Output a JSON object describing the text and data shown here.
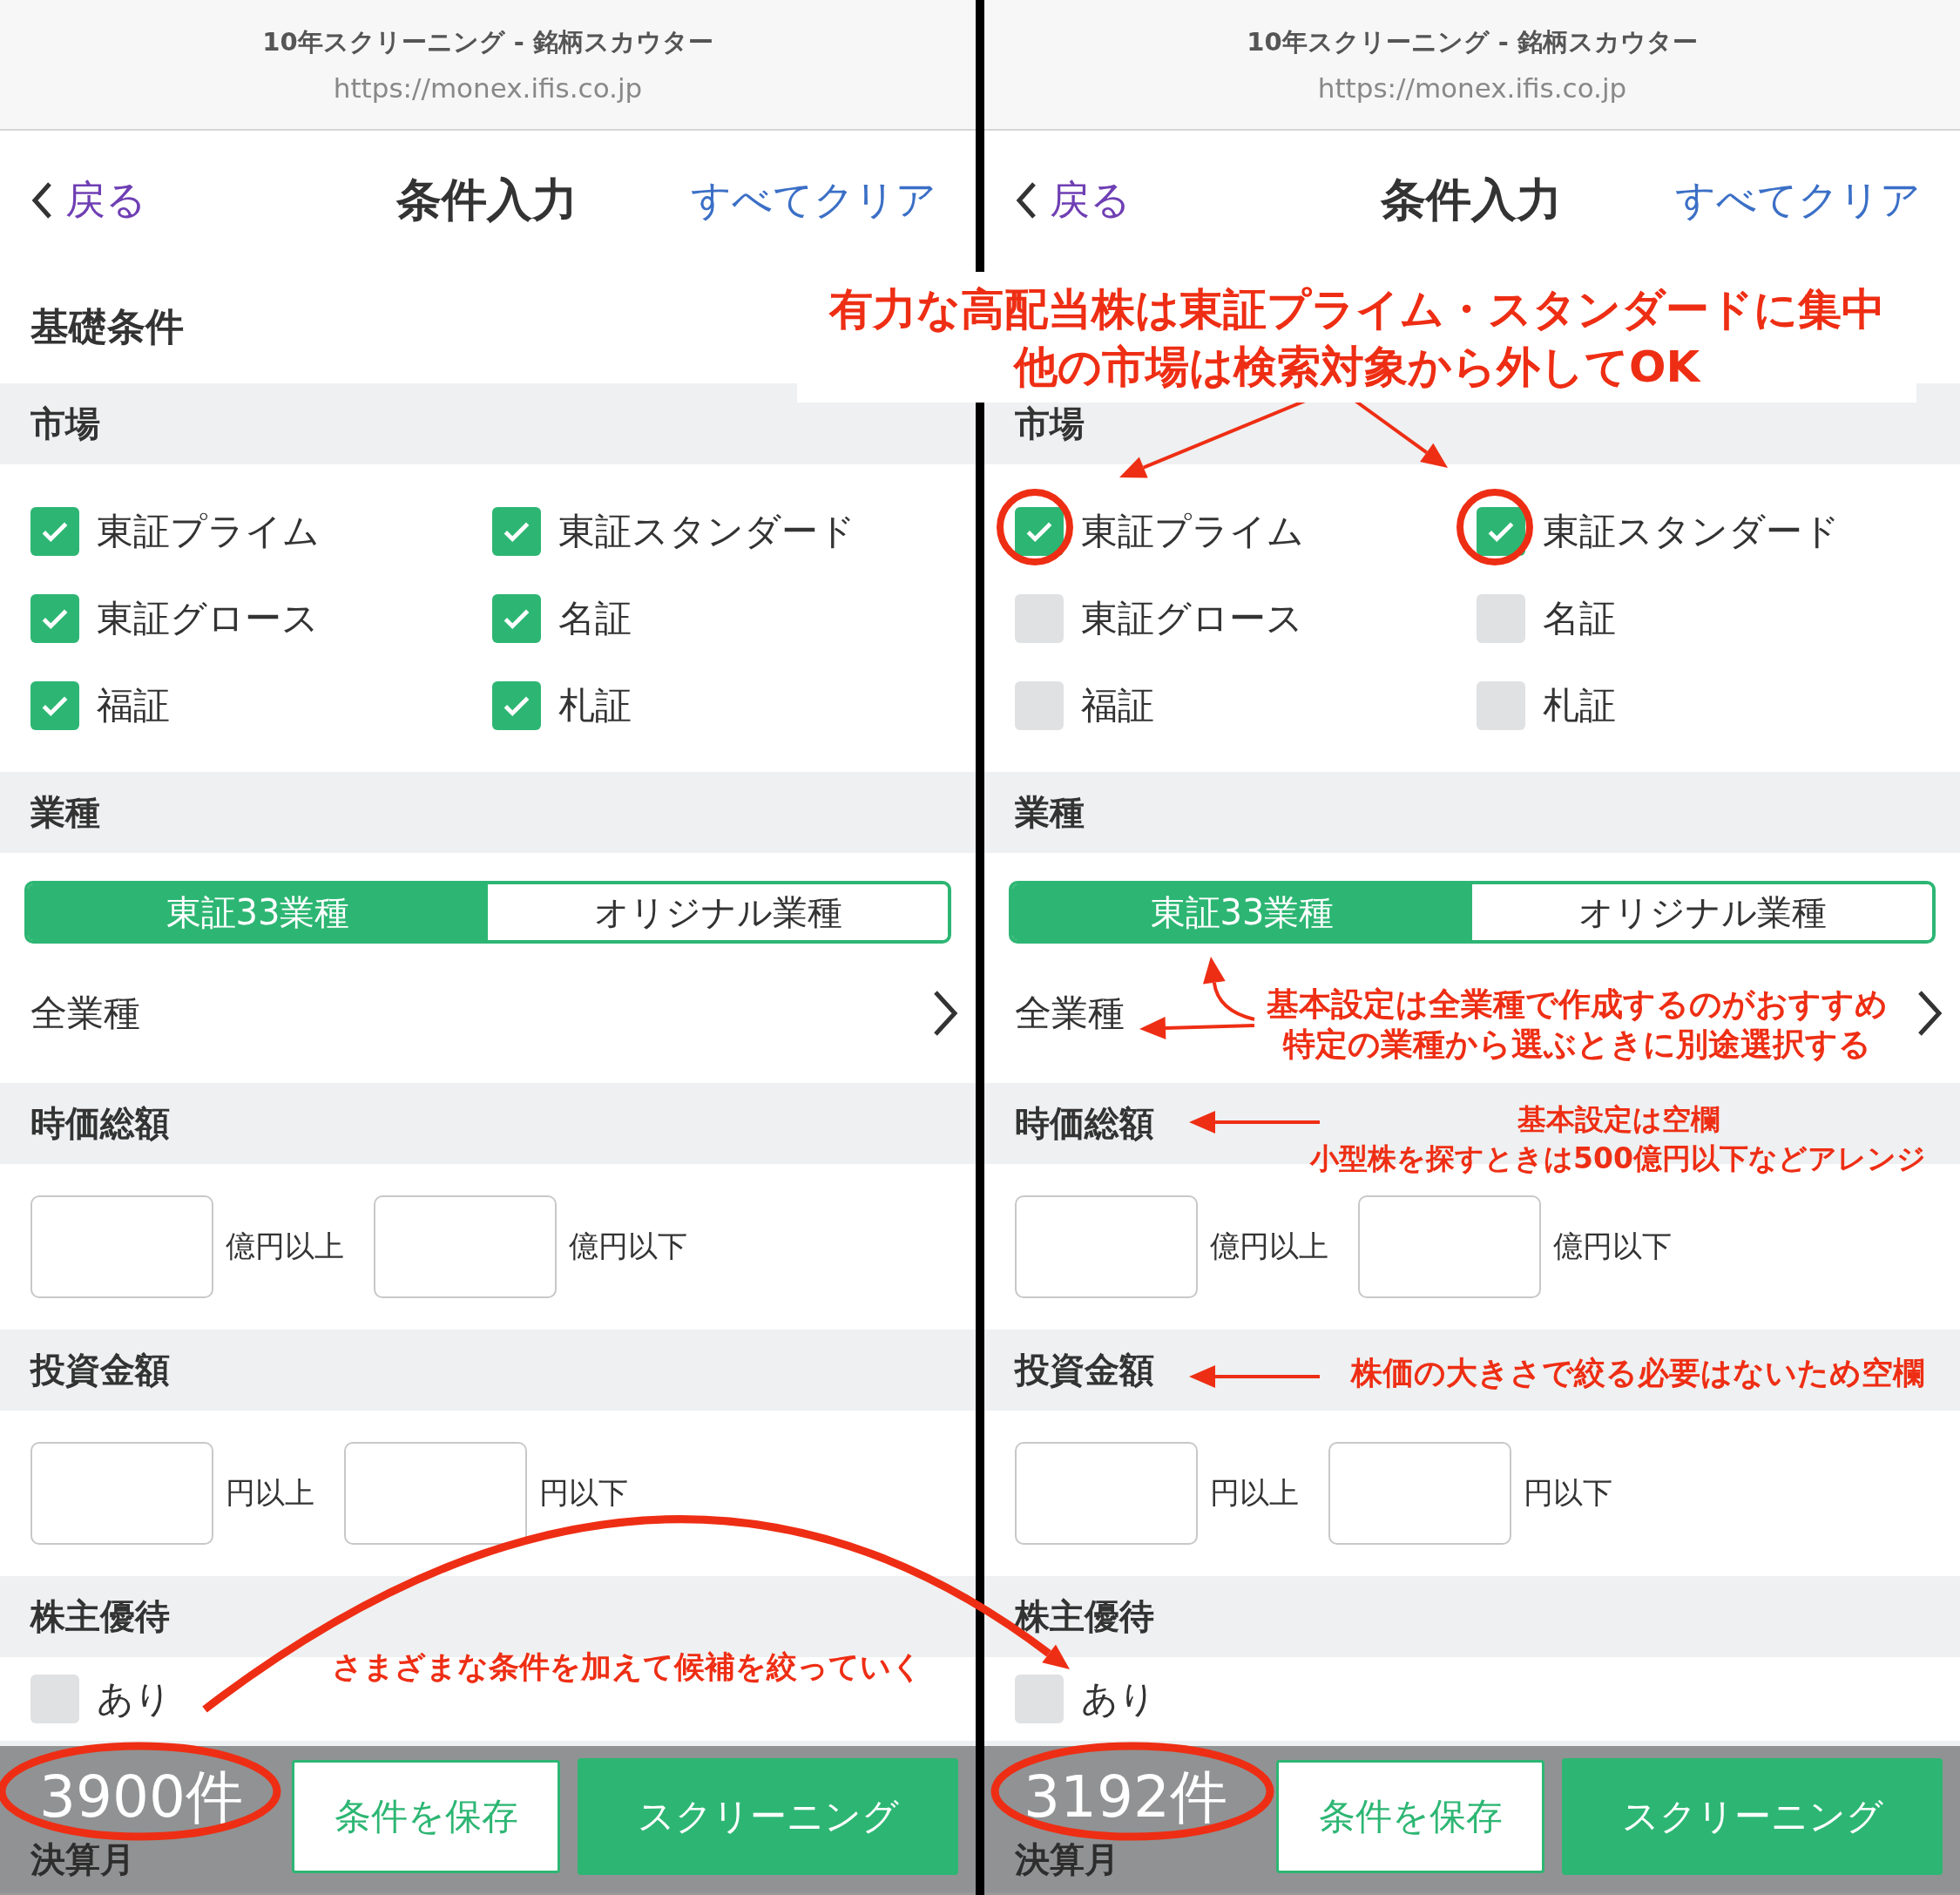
{
  "panels": [
    {
      "browser_title": "10年スクリーニング - 銘柄スカウター",
      "url": "https://monex.ifis.co.jp",
      "nav": {
        "back": "戻る",
        "title": "条件入力",
        "clear": "すべてクリア"
      },
      "basic_heading": "基礎条件",
      "market": {
        "heading": "市場",
        "options": [
          {
            "label": "東証プライム",
            "checked": true
          },
          {
            "label": "東証スタンダード",
            "checked": true
          },
          {
            "label": "東証グロース",
            "checked": true
          },
          {
            "label": "名証",
            "checked": true
          },
          {
            "label": "福証",
            "checked": true
          },
          {
            "label": "札証",
            "checked": true
          }
        ]
      },
      "industry": {
        "heading": "業種",
        "tabs": [
          {
            "label": "東証33業種",
            "selected": true
          },
          {
            "label": "オリジナル業種",
            "selected": false
          }
        ],
        "picker": "全業種"
      },
      "market_cap": {
        "heading": "時価総額",
        "fields": [
          {
            "unit": "億円以上"
          },
          {
            "unit": "億円以下"
          }
        ]
      },
      "investment": {
        "heading": "投資金額",
        "fields": [
          {
            "unit": "円以上"
          },
          {
            "unit": "円以下"
          }
        ]
      },
      "benefit": {
        "heading": "株主優待",
        "label": "あり",
        "checked": false
      },
      "settlement": {
        "heading": "決算月"
      },
      "footer": {
        "count": "3900件",
        "save": "条件を保存",
        "screen": "スクリーニング"
      }
    },
    {
      "browser_title": "10年スクリーニング - 銘柄スカウター",
      "url": "https://monex.ifis.co.jp",
      "nav": {
        "back": "戻る",
        "title": "条件入力",
        "clear": "すべてクリア"
      },
      "market": {
        "heading": "市場",
        "options": [
          {
            "label": "東証プライム",
            "checked": true
          },
          {
            "label": "東証スタンダード",
            "checked": true
          },
          {
            "label": "東証グロース",
            "checked": false
          },
          {
            "label": "名証",
            "checked": false
          },
          {
            "label": "福証",
            "checked": false
          },
          {
            "label": "札証",
            "checked": false
          }
        ]
      },
      "industry": {
        "heading": "業種",
        "tabs": [
          {
            "label": "東証33業種",
            "selected": true
          },
          {
            "label": "オリジナル業種",
            "selected": false
          }
        ],
        "picker": "全業種"
      },
      "market_cap": {
        "heading": "時価総額",
        "fields": [
          {
            "unit": "億円以上"
          },
          {
            "unit": "億円以下"
          }
        ]
      },
      "investment": {
        "heading": "投資金額",
        "fields": [
          {
            "unit": "円以上"
          },
          {
            "unit": "円以下"
          }
        ]
      },
      "benefit": {
        "heading": "株主優待",
        "label": "あり",
        "checked": false
      },
      "settlement": {
        "heading": "決算月"
      },
      "footer": {
        "count": "3192件",
        "save": "条件を保存",
        "screen": "スクリーニング"
      }
    }
  ],
  "annotations": [
    {
      "lines": [
        "有力な高配当株は東証プライム・スタンダードに集中",
        "他の市場は検索対象から外してOK"
      ]
    },
    {
      "lines": [
        "基本設定は全業種で作成するのがおすすめ",
        "特定の業種から選ぶときに別途選択する"
      ]
    },
    {
      "lines": [
        "基本設定は空欄",
        "小型株を探すときは500億円以下などアレンジ"
      ]
    },
    {
      "lines": [
        "株価の大きさで絞る必要はないため空欄"
      ]
    },
    {
      "lines": [
        "さまざまな条件を加えて候補を絞っていく"
      ]
    }
  ]
}
